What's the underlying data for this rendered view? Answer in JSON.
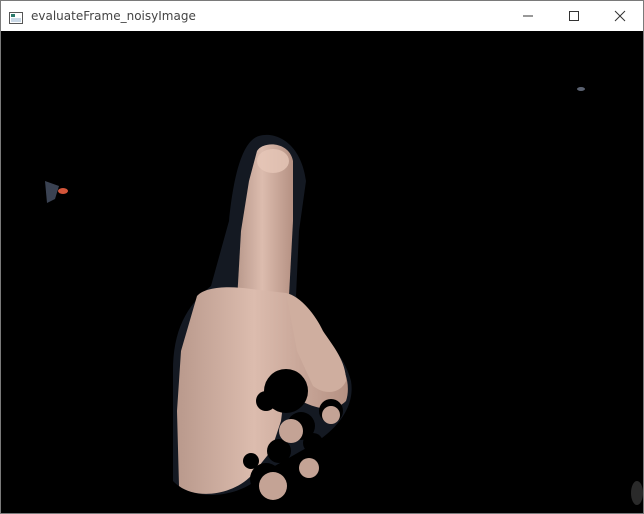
{
  "window": {
    "title": "evaluateFrame_noisyImage"
  },
  "controls": {
    "minimize_icon": "minimize-icon",
    "maximize_icon": "maximize-icon",
    "close_icon": "close-icon"
  },
  "image": {
    "description_icon": "hand-image"
  },
  "colors": {
    "background": "#000000",
    "titlebar": "#ffffff",
    "skin": "#d9b6a6"
  }
}
